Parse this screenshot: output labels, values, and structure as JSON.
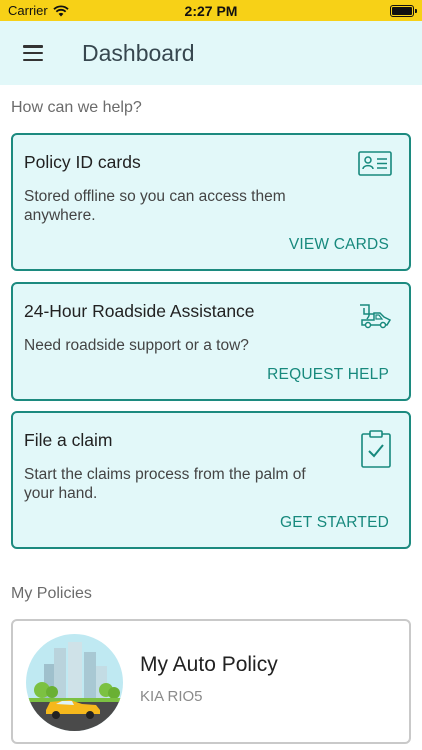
{
  "status_bar": {
    "carrier": "Carrier",
    "time": "2:27 PM",
    "icons": [
      "wifi-icon",
      "battery-icon"
    ]
  },
  "header": {
    "title": "Dashboard",
    "menu_icon": "hamburger-menu-icon"
  },
  "help_section": {
    "label": "How can we help?",
    "cards": [
      {
        "title": "Policy ID cards",
        "description": "Stored offline so you can access them anywhere.",
        "action": "VIEW CARDS",
        "icon": "id-card-icon"
      },
      {
        "title": "24-Hour Roadside Assistance",
        "description": "Need roadside support or a tow?",
        "action": "REQUEST HELP",
        "icon": "tow-truck-icon"
      },
      {
        "title": "File a claim",
        "description": "Start the claims process from the palm of your hand.",
        "action": "GET STARTED",
        "icon": "clipboard-check-icon"
      }
    ]
  },
  "policies_section": {
    "label": "My Policies",
    "policies": [
      {
        "name": "My Auto Policy",
        "vehicle": "KIA RIO5",
        "image": "city-car-illustration"
      }
    ]
  },
  "colors": {
    "accent": "#17897d",
    "card_background": "#e2f8f9",
    "status_bar": "#f7d117"
  }
}
